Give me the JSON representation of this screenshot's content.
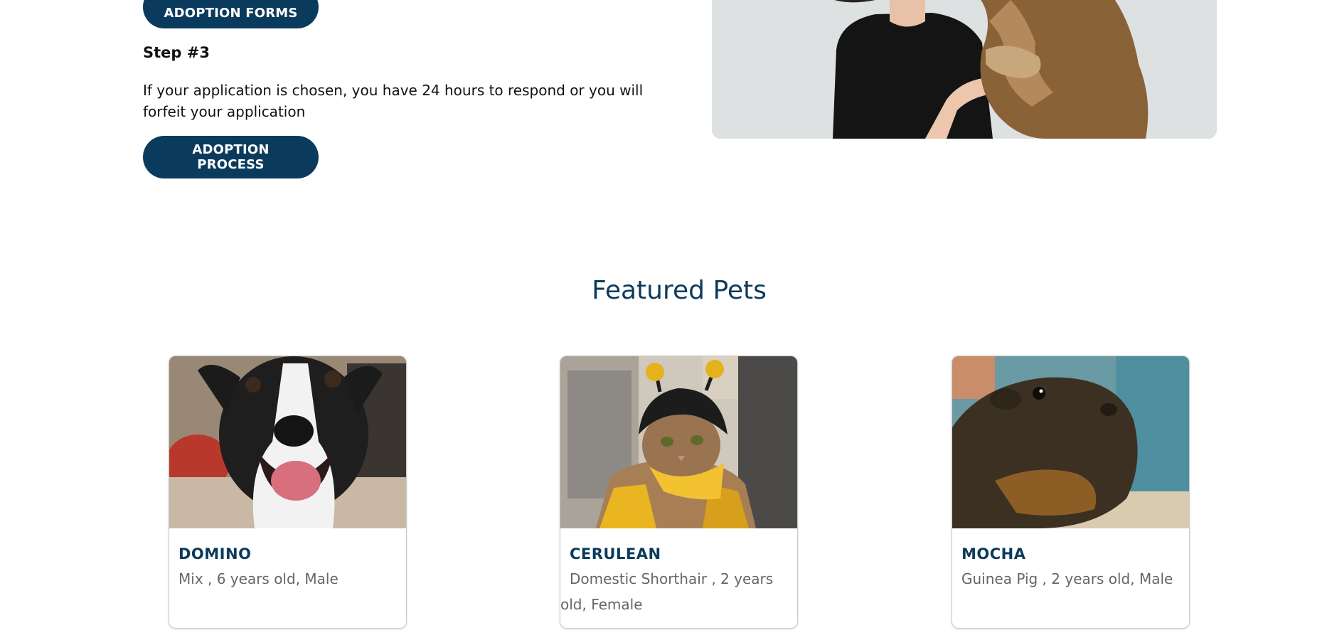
{
  "adoption": {
    "forms_button": "ADOPTION FORMS",
    "step_heading": "Step #3",
    "step_text": "If your application is chosen, you have 24 hours to respond or you will forfeit your application",
    "process_button": "ADOPTION PROCESS"
  },
  "featured": {
    "title": "Featured Pets",
    "pets": [
      {
        "name": "DOMINO",
        "description": "Mix , 6 years old, Male",
        "photo_icon": "dog-photo"
      },
      {
        "name": "CERULEAN",
        "description": "Domestic Shorthair , 2 years old, Female",
        "photo_icon": "cat-photo"
      },
      {
        "name": "MOCHA",
        "description": "Guinea Pig , 2 years old, Male",
        "photo_icon": "guinea-pig-photo"
      }
    ]
  },
  "colors": {
    "brand_navy": "#0b3b5c",
    "description_gray": "#666666",
    "page_background": "#ffffff"
  }
}
